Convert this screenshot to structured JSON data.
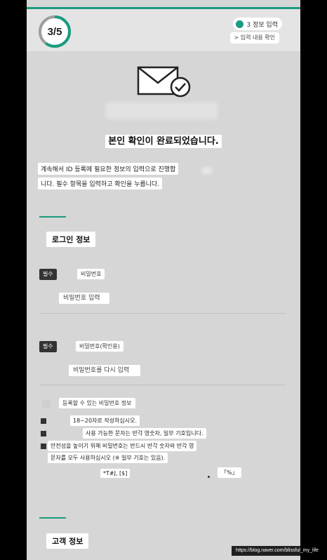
{
  "progress": {
    "label": "3/5",
    "fraction": 0.6
  },
  "steps": {
    "current": "3 정보 입력",
    "sub": "> 입력 내용 확인"
  },
  "status": {
    "title": "본인 확인이 완료되었습니다.",
    "desc_line1": "계속해서 ID 등록에 필요한 정보의 입력으로 진행합",
    "desc_line2": "니다. 필수 항목을 입력하고 확인을 누릅니다."
  },
  "login_section": {
    "title": "로그인 정보",
    "password": {
      "badge": "필수",
      "label": "비밀번호",
      "placeholder": "비밀번호 입력"
    },
    "password_confirm": {
      "badge": "필수",
      "label": "비밀번호(확인용)",
      "placeholder": "비밀번호를 다시 입력"
    }
  },
  "rules": {
    "title": "등록할 수 있는 비밀번호 정보",
    "items": [
      "18~20자로 작성하십시오.",
      "사용 가능한 문자는 반각 영숫자, 일부 기호입니다.",
      "안전성을 높이기 위해 비밀번호는 반드시 반각 숫자와 반각 영",
      "문자를 모두 사용하십시오 (※ 일부 기호는 있음)."
    ],
    "special_chars": "*T#J, [$]",
    "special_end": "「%」"
  },
  "customer_section": {
    "title": "고객 정보"
  },
  "watermark": "https://blog.naver.com/blissful_my_life",
  "colors": {
    "accent": "#1a9c80",
    "page_bg": "#d6d6d6",
    "header_bg": "#e4e4e4"
  },
  "icons": {
    "envelope": "envelope-check-icon"
  }
}
